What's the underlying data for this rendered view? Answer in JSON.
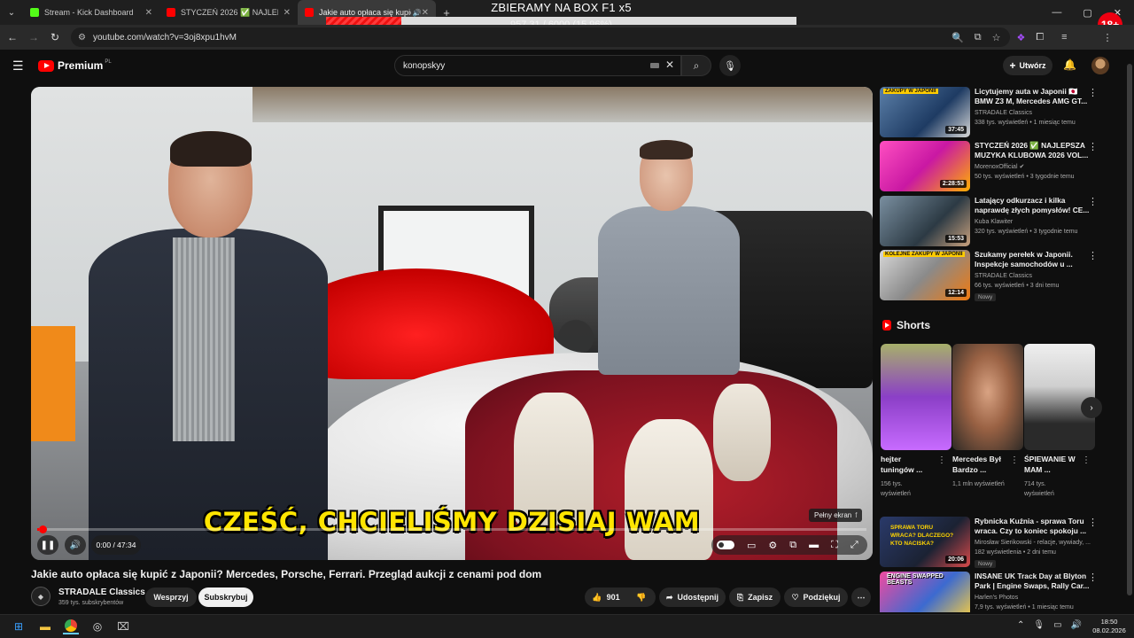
{
  "browser": {
    "tabs": [
      {
        "title": "Stream - Kick Dashboard",
        "favicon_color": "#53fc18"
      },
      {
        "title": "STYCZEŃ 2026 ✅ NAJLEPSZA",
        "favicon_color": "#ff0000"
      },
      {
        "title": "Jakie auto opłaca się kupić",
        "favicon_color": "#ff0000"
      }
    ],
    "url": "youtube.com/watch?v=3oj8xpu1hvM",
    "age_badge": "18+"
  },
  "overlay": {
    "title": "ZBIERAMY NA BOX F1 x5",
    "progress_text": "957.31 / 6000 (15.96%)",
    "progress_fraction": 0.1596
  },
  "youtube": {
    "logo_text": "Premium",
    "logo_region": "PL",
    "search_value": "konopskyy",
    "create_label": "Utwórz"
  },
  "player": {
    "subtitle": "CZEŚĆ, CHCIELIŚMY DZISIAJ WAM",
    "tooltip_label": "Pełny ekran",
    "tooltip_key": "f",
    "time": "0:00 / 47:34",
    "progress_fraction": 0.002
  },
  "video": {
    "title": "Jakie auto opłaca się kupić z Japonii? Mercedes, Porsche, Ferrari. Przegląd aukcji z cenami pod dom",
    "channel": "STRADALE Classics",
    "subscribers": "359 tys. subskrybentów",
    "support_label": "Wesprzyj",
    "subscribe_label": "Subskrybuj",
    "likes": "901",
    "share_label": "Udostępnij",
    "save_label": "Zapisz",
    "thanks_label": "Podziękuj"
  },
  "recommendations": [
    {
      "title": "Licytujemy auta w Japonii 🇯🇵 BMW Z3 M, Mercedes AMG GT...",
      "channel": "STRADALE Classics",
      "meta": "338 tys. wyświetleń • 1 miesiąc temu",
      "duration": "37:45",
      "caption": "ZAKUPY W JAPONII",
      "badge": ""
    },
    {
      "title": "STYCZEŃ 2026 ✅ NAJLEPSZA MUZYKA KLUBOWA 2026 VOL...",
      "channel": "MorenoxOfficial ✔",
      "meta": "50 tys. wyświetleń • 3 tygodnie temu",
      "duration": "2:28:53",
      "caption": "",
      "badge": ""
    },
    {
      "title": "Latający odkurzacz i kilka naprawdę złych pomysłów! CE...",
      "channel": "Kuba Klawiter",
      "meta": "320 tys. wyświetleń • 3 tygodnie temu",
      "duration": "15:53",
      "caption": "",
      "badge": ""
    },
    {
      "title": "Szukamy perełek w Japonii. Inspekcje samochodów u ...",
      "channel": "STRADALE Classics",
      "meta": "66 tys. wyświetleń • 3 dni temu",
      "duration": "12:14",
      "caption": "KOLEJNE ZAKUPY W JAPONII",
      "badge": "Nowy"
    }
  ],
  "shorts_heading": "Shorts",
  "shorts": [
    {
      "title": "hejter tuningów ...",
      "meta": "156 tys. wyświetleń"
    },
    {
      "title": "Mercedes Był Bardzo ...",
      "meta": "1,1 mln wyświetleń"
    },
    {
      "title": "ŚPIEWANIE W MAM ...",
      "meta": "714 tys. wyświetleń"
    }
  ],
  "recommendations2": [
    {
      "title": "Rybnicka Kuźnia - sprawa Toru wraca. Czy to koniec spokoju ...",
      "channel": "Mirosław Sierikowski - relacje, wywiady, ...",
      "meta": "182 wyświetlenia • 2 dni temu",
      "duration": "20:06",
      "caption": "SPRAWA TORU WRACA? DLACZEGO? KTO NACISKA?",
      "badge": "Nowy"
    },
    {
      "title": "INSANE UK Track Day at Blyton Park | Engine Swaps, Rally Car...",
      "channel": "Harlen's Photos",
      "meta": "7,9 tys. wyświetleń • 1 miesiąc temu",
      "duration": "",
      "caption": "ENGINE SWAPPED BEASTS",
      "badge": ""
    }
  ],
  "taskbar": {
    "time": "18:50",
    "date": "08.02.2026"
  }
}
